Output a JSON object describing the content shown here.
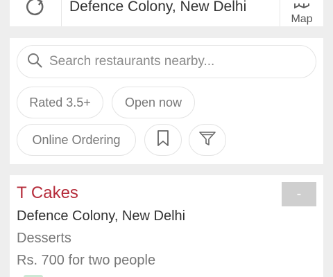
{
  "header": {
    "location": "Defence Colony, New Delhi",
    "map_label": "Map"
  },
  "search": {
    "placeholder": "Search restaurants nearby..."
  },
  "filters": {
    "rated": "Rated 3.5+",
    "open_now": "Open now",
    "online_ordering": "Online Ordering"
  },
  "restaurant": {
    "name": "T Cakes",
    "location": "Defence Colony, New Delhi",
    "cuisine": "Desserts",
    "cost": "Rs. 700 for two people",
    "rating": "-"
  },
  "colors": {
    "brand_red": "#b52b3a",
    "rating_badge": "#cfcfcf"
  }
}
